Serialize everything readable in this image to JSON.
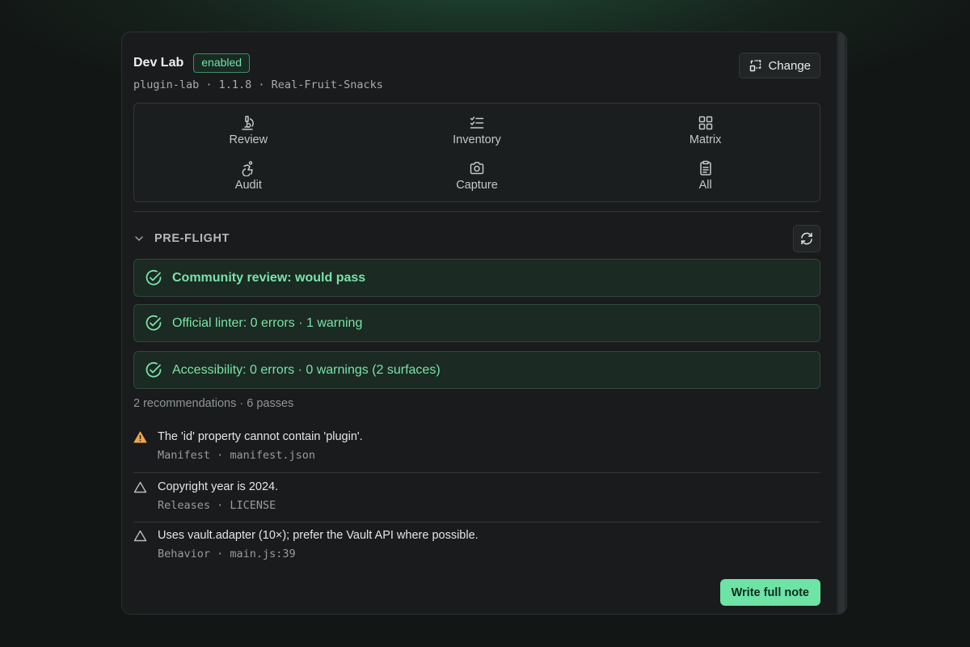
{
  "header": {
    "title": "Dev Lab",
    "badge": "enabled",
    "subtitle": "plugin-lab · 1.1.8 · Real-Fruit-Snacks",
    "change_label": "Change"
  },
  "tools": [
    {
      "label": "Review",
      "icon": "microscope-icon"
    },
    {
      "label": "Inventory",
      "icon": "list-checks-icon"
    },
    {
      "label": "Matrix",
      "icon": "grid-icon"
    },
    {
      "label": "Audit",
      "icon": "accessibility-icon"
    },
    {
      "label": "Capture",
      "icon": "camera-icon"
    },
    {
      "label": "All",
      "icon": "clipboard-list-icon"
    }
  ],
  "preflight": {
    "title": "PRE-FLIGHT",
    "checks": [
      {
        "label": "Community review: would pass"
      },
      {
        "label": "Official linter: 0 errors · 1 warning"
      },
      {
        "label": "Accessibility: 0 errors · 0 warnings (2 surfaces)"
      }
    ],
    "summary": "2 recommendations · 6 passes",
    "issues": [
      {
        "message": "The 'id' property cannot contain 'plugin'.",
        "meta": "Manifest · manifest.json",
        "severity": "warning"
      },
      {
        "message": "Copyright year is 2024.",
        "meta": "Releases · LICENSE",
        "severity": "recommendation"
      },
      {
        "message": "Uses vault.adapter (10×); prefer the Vault API where possible.",
        "meta": "Behavior · main.js:39",
        "severity": "recommendation"
      }
    ]
  },
  "actions": {
    "write_label": "Write full note"
  },
  "colors": {
    "accent": "#6de3a6",
    "success_text": "#79e3a9",
    "warning": "#f0a54a"
  }
}
